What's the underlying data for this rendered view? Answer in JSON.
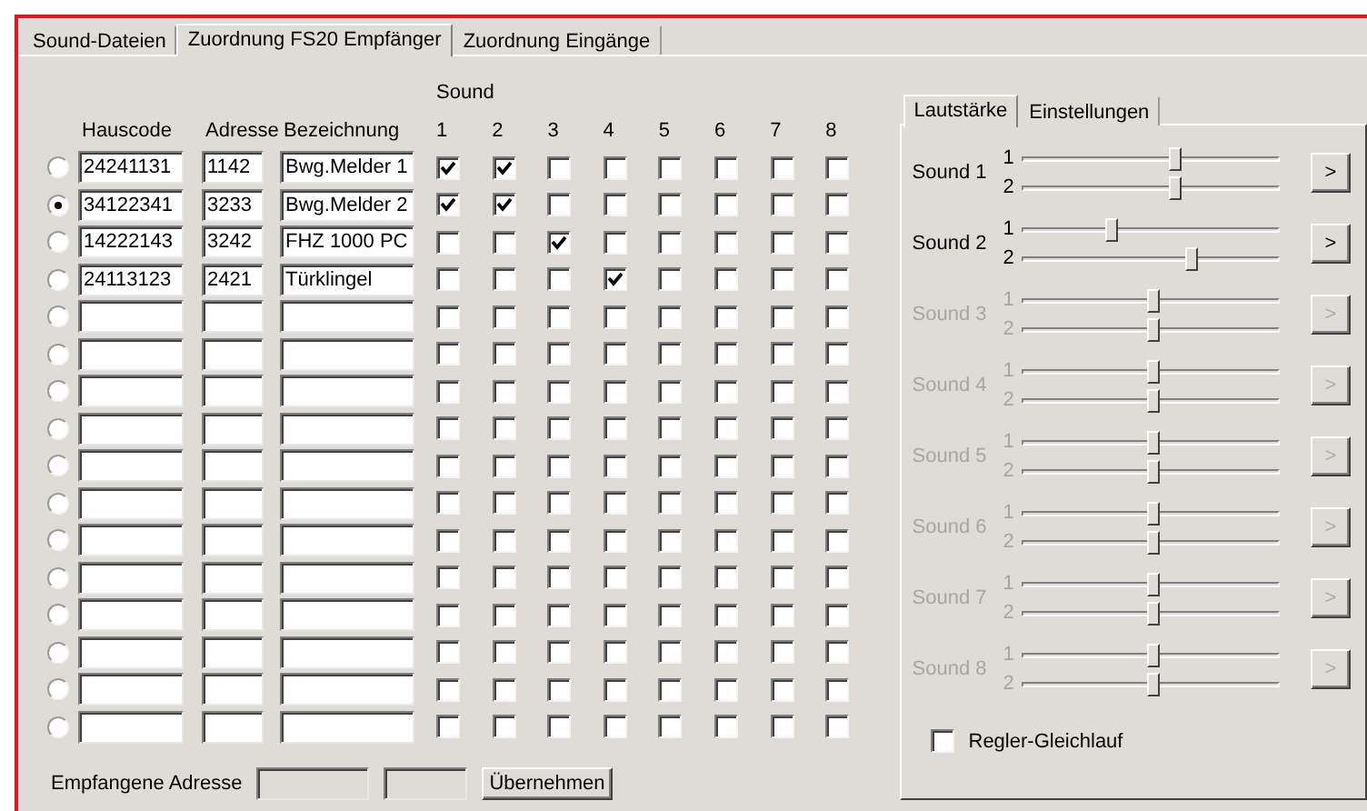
{
  "main_tabs": [
    {
      "label": "Sound-Dateien",
      "selected": false
    },
    {
      "label": "Zuordnung FS20 Empfänger",
      "selected": true
    },
    {
      "label": "Zuordnung Eingänge",
      "selected": false
    }
  ],
  "table": {
    "group_header": "Sound",
    "columns": [
      "Hauscode",
      "Adresse",
      "Bezeichnung",
      "1",
      "2",
      "3",
      "4",
      "5",
      "6",
      "7",
      "8"
    ],
    "rows": [
      {
        "selected": false,
        "hauscode": "24241131",
        "adresse": "1142",
        "bezeichnung": "Bwg.Melder 1",
        "sounds": [
          true,
          true,
          false,
          false,
          false,
          false,
          false,
          false
        ]
      },
      {
        "selected": true,
        "hauscode": "34122341",
        "adresse": "3233",
        "bezeichnung": "Bwg.Melder 2",
        "sounds": [
          true,
          true,
          false,
          false,
          false,
          false,
          false,
          false
        ]
      },
      {
        "selected": false,
        "hauscode": "14222143",
        "adresse": "3242",
        "bezeichnung": "FHZ 1000 PC",
        "sounds": [
          false,
          false,
          true,
          false,
          false,
          false,
          false,
          false
        ]
      },
      {
        "selected": false,
        "hauscode": "24113123",
        "adresse": "2421",
        "bezeichnung": "Türklingel",
        "sounds": [
          false,
          false,
          false,
          true,
          false,
          false,
          false,
          false
        ]
      },
      {
        "selected": false,
        "sounds": [
          false,
          false,
          false,
          false,
          false,
          false,
          false,
          false
        ]
      },
      {
        "selected": false,
        "sounds": [
          false,
          false,
          false,
          false,
          false,
          false,
          false,
          false
        ]
      },
      {
        "selected": false,
        "sounds": [
          false,
          false,
          false,
          false,
          false,
          false,
          false,
          false
        ]
      },
      {
        "selected": false,
        "sounds": [
          false,
          false,
          false,
          false,
          false,
          false,
          false,
          false
        ]
      },
      {
        "selected": false,
        "sounds": [
          false,
          false,
          false,
          false,
          false,
          false,
          false,
          false
        ]
      },
      {
        "selected": false,
        "sounds": [
          false,
          false,
          false,
          false,
          false,
          false,
          false,
          false
        ]
      },
      {
        "selected": false,
        "sounds": [
          false,
          false,
          false,
          false,
          false,
          false,
          false,
          false
        ]
      },
      {
        "selected": false,
        "sounds": [
          false,
          false,
          false,
          false,
          false,
          false,
          false,
          false
        ]
      },
      {
        "selected": false,
        "sounds": [
          false,
          false,
          false,
          false,
          false,
          false,
          false,
          false
        ]
      },
      {
        "selected": false,
        "sounds": [
          false,
          false,
          false,
          false,
          false,
          false,
          false,
          false
        ]
      },
      {
        "selected": false,
        "sounds": [
          false,
          false,
          false,
          false,
          false,
          false,
          false,
          false
        ]
      },
      {
        "selected": false,
        "sounds": [
          false,
          false,
          false,
          false,
          false,
          false,
          false,
          false
        ]
      }
    ]
  },
  "footer": {
    "label": "Empfangene Adresse",
    "button": "Übernehmen"
  },
  "side_panel": {
    "tabs": [
      {
        "label": "Lautstärke",
        "selected": true
      },
      {
        "label": "Einstellungen",
        "selected": false
      }
    ],
    "sounds": [
      {
        "label": "Sound 1",
        "disabled": false,
        "button": ">",
        "sliders": [
          {
            "label": "1",
            "level": 0.6
          },
          {
            "label": "2",
            "level": 0.6
          }
        ]
      },
      {
        "label": "Sound 2",
        "disabled": false,
        "button": ">",
        "sliders": [
          {
            "label": "1",
            "level": 0.34
          },
          {
            "label": "2",
            "level": 0.67
          }
        ]
      },
      {
        "label": "Sound 3",
        "disabled": true,
        "button": ">",
        "sliders": [
          {
            "label": "1",
            "level": 0.51
          },
          {
            "label": "2",
            "level": 0.51
          }
        ]
      },
      {
        "label": "Sound 4",
        "disabled": true,
        "button": ">",
        "sliders": [
          {
            "label": "1",
            "level": 0.51
          },
          {
            "label": "2",
            "level": 0.51
          }
        ]
      },
      {
        "label": "Sound 5",
        "disabled": true,
        "button": ">",
        "sliders": [
          {
            "label": "1",
            "level": 0.51
          },
          {
            "label": "2",
            "level": 0.51
          }
        ]
      },
      {
        "label": "Sound 6",
        "disabled": true,
        "button": ">",
        "sliders": [
          {
            "label": "1",
            "level": 0.51
          },
          {
            "label": "2",
            "level": 0.51
          }
        ]
      },
      {
        "label": "Sound 7",
        "disabled": true,
        "button": ">",
        "sliders": [
          {
            "label": "1",
            "level": 0.51
          },
          {
            "label": "2",
            "level": 0.51
          }
        ]
      },
      {
        "label": "Sound 8",
        "disabled": true,
        "button": ">",
        "sliders": [
          {
            "label": "1",
            "level": 0.51
          },
          {
            "label": "2",
            "level": 0.51
          }
        ]
      }
    ],
    "sync_checkbox": {
      "label": "Regler-Gleichlauf",
      "checked": false
    }
  }
}
